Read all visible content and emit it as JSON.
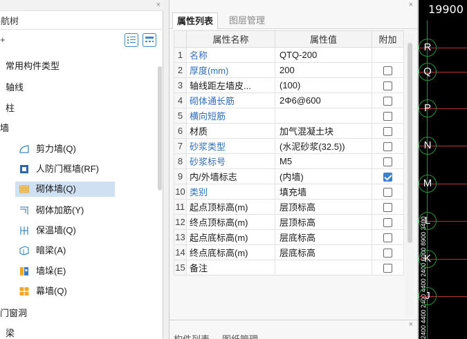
{
  "nav": {
    "title": "导航树",
    "plus": "+",
    "close": "×",
    "items": [
      {
        "label": "常用构件类型",
        "icon": ""
      },
      {
        "label": "轴线",
        "icon": ""
      },
      {
        "label": "柱",
        "icon": ""
      },
      {
        "label": "墙",
        "icon": ""
      },
      {
        "label": "剪力墙(Q)",
        "icon": "shear-wall-icon"
      },
      {
        "label": "人防门框墙(RF)",
        "icon": "civil-defense-door-wall-icon"
      },
      {
        "label": "砌体墙(Q)",
        "icon": "masonry-wall-icon"
      },
      {
        "label": "砌体加筋(Y)",
        "icon": "masonry-reinforcement-icon"
      },
      {
        "label": "保温墙(Q)",
        "icon": "insulation-wall-icon"
      },
      {
        "label": "暗梁(A)",
        "icon": "concealed-beam-icon"
      },
      {
        "label": "墙垛(E)",
        "icon": "wall-pier-icon"
      },
      {
        "label": "幕墙(Q)",
        "icon": "curtain-wall-icon"
      },
      {
        "label": "门窗洞",
        "icon": ""
      },
      {
        "label": "梁",
        "icon": ""
      }
    ]
  },
  "props": {
    "close": "×",
    "tabs": [
      "属性列表",
      "图层管理"
    ],
    "headers": [
      "",
      "属性名称",
      "属性值",
      "附加"
    ],
    "rows": [
      {
        "num": "1",
        "name": "名称",
        "value": "QTQ-200",
        "checked": null,
        "blue": true
      },
      {
        "num": "2",
        "name": "厚度(mm)",
        "value": "200",
        "checked": false,
        "blue": true
      },
      {
        "num": "3",
        "name": "轴线距左墙皮...",
        "value": "(100)",
        "checked": false,
        "blue": false
      },
      {
        "num": "4",
        "name": "砌体通长筋",
        "value": "2Φ6@600",
        "checked": false,
        "blue": true
      },
      {
        "num": "5",
        "name": "横向短筋",
        "value": "",
        "checked": false,
        "blue": true
      },
      {
        "num": "6",
        "name": "材质",
        "value": "加气混凝土块",
        "checked": false,
        "blue": false
      },
      {
        "num": "7",
        "name": "砂浆类型",
        "value": "(水泥砂浆(32.5))",
        "checked": false,
        "blue": true
      },
      {
        "num": "8",
        "name": "砂浆标号",
        "value": "M5",
        "checked": false,
        "blue": true
      },
      {
        "num": "9",
        "name": "内/外墙标志",
        "value": "(内墙)",
        "checked": true,
        "blue": false
      },
      {
        "num": "10",
        "name": "类别",
        "value": "填充墙",
        "checked": false,
        "blue": true
      },
      {
        "num": "11",
        "name": "起点顶标高(m)",
        "value": "层顶标高",
        "checked": false,
        "blue": false
      },
      {
        "num": "12",
        "name": "终点顶标高(m)",
        "value": "层顶标高",
        "checked": false,
        "blue": false
      },
      {
        "num": "13",
        "name": "起点底标高(m)",
        "value": "层底标高",
        "checked": false,
        "blue": false
      },
      {
        "num": "14",
        "name": "终点底标高(m)",
        "value": "层底标高",
        "checked": false,
        "blue": false
      },
      {
        "num": "15",
        "name": "备注",
        "value": "",
        "checked": false,
        "blue": false
      }
    ],
    "lower_close": "×",
    "lower_tabs": [
      "构件列表",
      "图纸管理"
    ]
  },
  "canvas": {
    "coordinate": "19900",
    "axes": [
      "R",
      "Q",
      "P",
      "N",
      "M",
      "L",
      "K",
      "J"
    ],
    "dims": "2400 4400 2400 4400 2400 6000 8900 3400",
    "colors": {
      "axis_line": "#c03030",
      "bubble": "#1e9a3a",
      "background": "#000000"
    }
  }
}
